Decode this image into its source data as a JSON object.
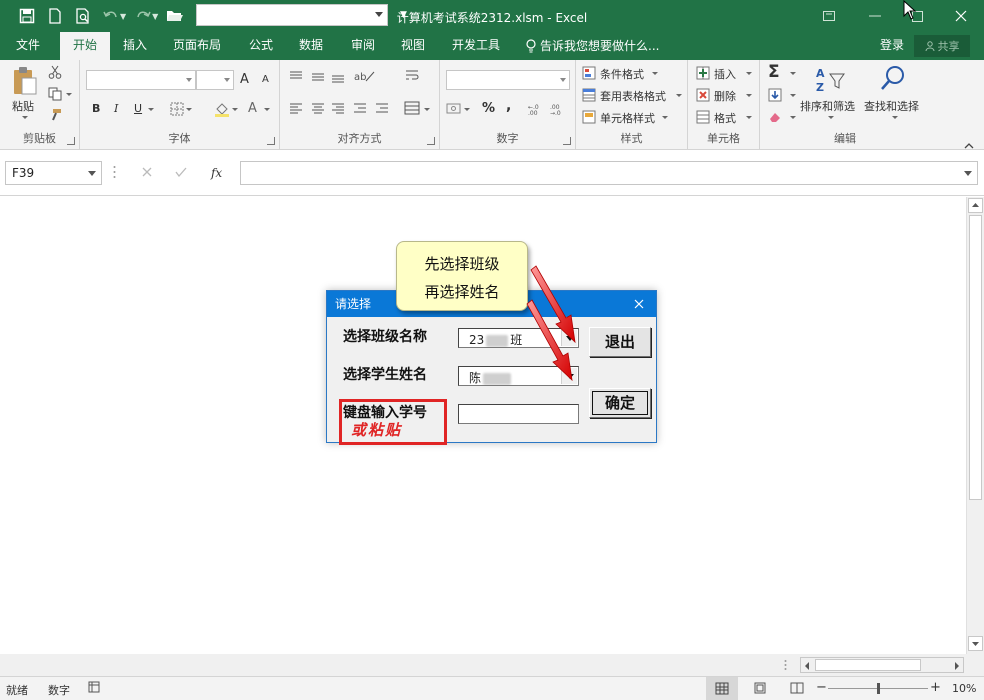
{
  "window": {
    "title": "计算机考试系统2312.xlsm - Excel"
  },
  "ribbon_tabs": [
    "文件",
    "开始",
    "插入",
    "页面布局",
    "公式",
    "数据",
    "审阅",
    "视图",
    "开发工具"
  ],
  "active_tab": "开始",
  "tell_me": "告诉我您想要做什么...",
  "account": {
    "login": "登录",
    "share": "共享"
  },
  "ribbon": {
    "clipboard": {
      "paste": "粘贴",
      "label": "剪贴板"
    },
    "font": {
      "bold": "B",
      "italic": "I",
      "underline": "U",
      "grow": "A",
      "shrink": "A",
      "font_color": "A",
      "label": "字体"
    },
    "alignment": {
      "label": "对齐方式"
    },
    "number": {
      "percent": "%",
      "comma": ",",
      "label": "数字"
    },
    "styles": {
      "conditional": "条件格式",
      "table": "套用表格格式",
      "cell": "单元格样式",
      "label": "样式"
    },
    "cells": {
      "insert": "插入",
      "delete": "删除",
      "format": "格式",
      "label": "单元格"
    },
    "editing": {
      "sort": "排序和筛选",
      "find": "查找和选择",
      "label": "编辑"
    }
  },
  "formula_bar": {
    "name_box": "F39",
    "fx": "fx",
    "value": ""
  },
  "dialog": {
    "title": "请选择",
    "class_label": "选择班级名称",
    "class_value_prefix": "23",
    "class_value_suffix": "班",
    "student_label": "选择学生姓名",
    "student_value_prefix": "陈",
    "keyboard_label": "键盘输入学号",
    "paste_note": "或粘贴",
    "exit_button": "退出",
    "ok_button": "确定"
  },
  "callout": {
    "line1": "先选择班级",
    "line2": "再选择姓名"
  },
  "status_bar": {
    "ready": "就绪",
    "numlock": "数字",
    "zoom": "10%"
  },
  "colors": {
    "excel_green": "#217346",
    "dialog_blue": "#0a78d7",
    "callout_bg": "#ffffc6",
    "annotation_red": "#e02525"
  }
}
